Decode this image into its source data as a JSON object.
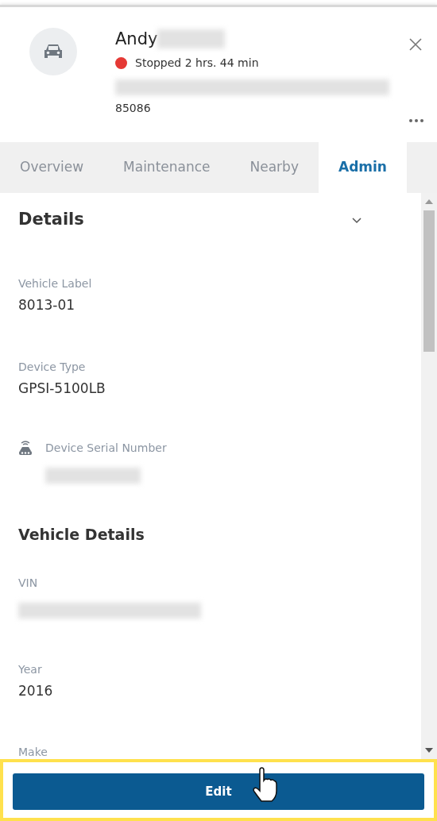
{
  "header": {
    "name": "Andy",
    "name_redacted": true,
    "status": {
      "text": "Stopped 2 hrs. 44 min",
      "color": "#e53935"
    },
    "address_redacted": true,
    "id": "85086"
  },
  "tabs": [
    {
      "label": "Overview",
      "selected": false
    },
    {
      "label": "Maintenance",
      "selected": false
    },
    {
      "label": "Nearby",
      "selected": false
    },
    {
      "label": "Admin",
      "selected": true
    }
  ],
  "panel": {
    "title": "Details",
    "expanded": true,
    "items": [
      {
        "kind": "field",
        "label": "Vehicle Label",
        "value": "8013-01"
      },
      {
        "kind": "field",
        "label": "Device Type",
        "value": "GPSI-5100LB"
      },
      {
        "kind": "device-field",
        "label": "Device Serial Number",
        "redacted": true
      },
      {
        "kind": "section",
        "label": "Vehicle Details"
      },
      {
        "kind": "field",
        "label": "VIN",
        "redacted": true
      },
      {
        "kind": "field",
        "label": "Year",
        "value": "2016"
      },
      {
        "kind": "field",
        "label": "Make"
      }
    ]
  },
  "edit_button": {
    "label": "Edit",
    "highlighted": true
  }
}
